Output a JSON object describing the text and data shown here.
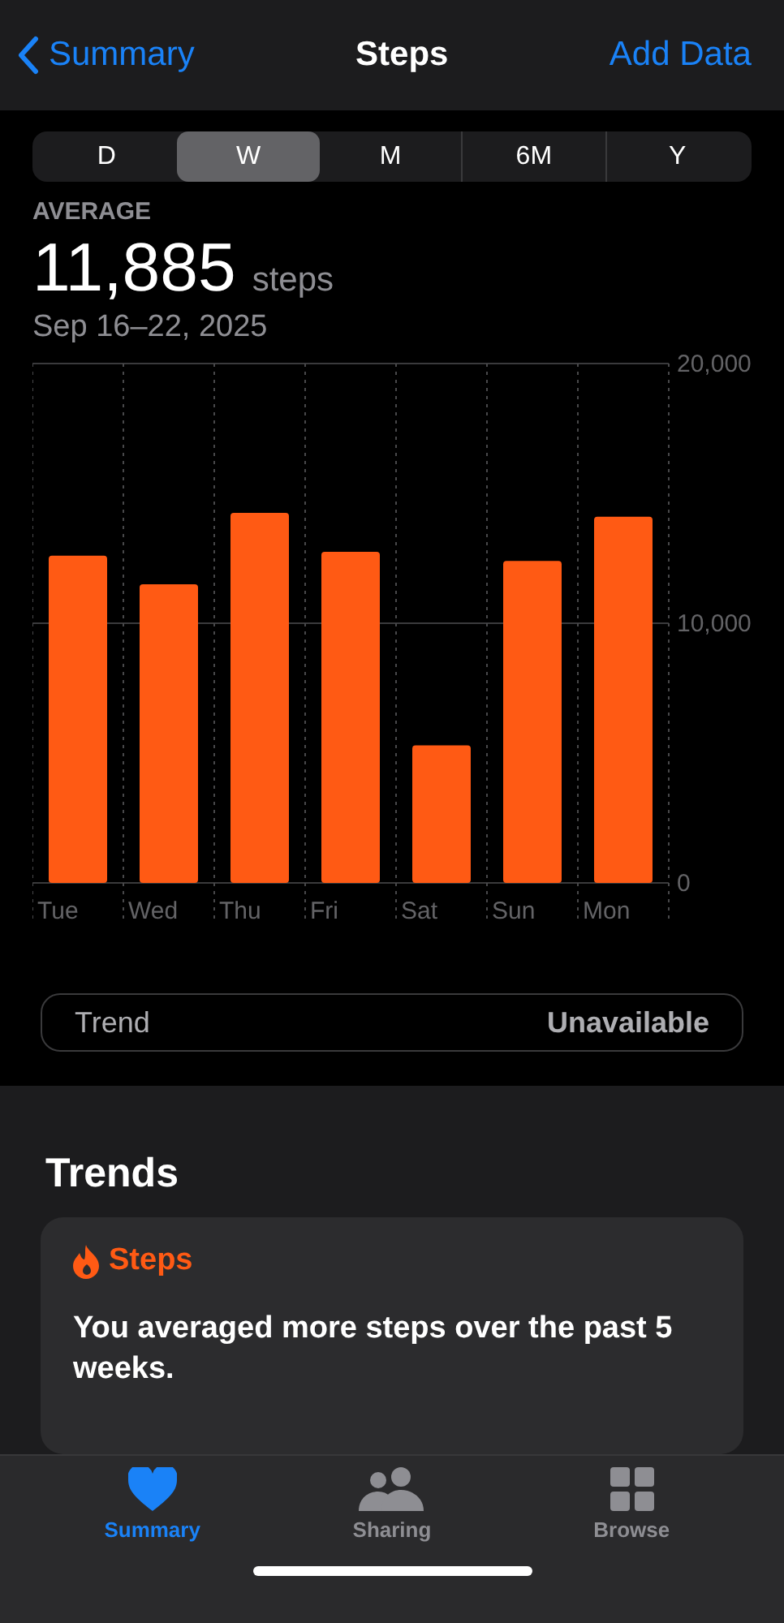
{
  "nav": {
    "back": "Summary",
    "title": "Steps",
    "action": "Add Data"
  },
  "ranges": [
    {
      "label": "D",
      "selected": false
    },
    {
      "label": "W",
      "selected": true
    },
    {
      "label": "M",
      "selected": false
    },
    {
      "label": "6M",
      "selected": false
    },
    {
      "label": "Y",
      "selected": false
    }
  ],
  "summary": {
    "label": "AVERAGE",
    "value": "11,885",
    "unit": "steps",
    "dates": "Sep 16–22, 2025"
  },
  "chart_data": {
    "type": "bar",
    "categories": [
      "Tue",
      "Wed",
      "Thu",
      "Fri",
      "Sat",
      "Sun",
      "Mon"
    ],
    "series": [
      {
        "color": "#ff5a14",
        "values": [
          12600,
          11500,
          14250,
          12750,
          5300,
          12400,
          14100
        ]
      }
    ],
    "ylim": [
      0,
      20000
    ],
    "yticks": [
      {
        "value": 0,
        "label": "0"
      },
      {
        "value": 10000,
        "label": "10,000"
      },
      {
        "value": 20000,
        "label": "20,000"
      }
    ]
  },
  "trend_row": {
    "label": "Trend",
    "value": "Unavailable"
  },
  "trends": {
    "heading": "Trends",
    "card": {
      "title": "Steps",
      "text": "You averaged more steps over the past 5 weeks."
    }
  },
  "tab_bar": [
    {
      "label": "Summary",
      "selected": true
    },
    {
      "label": "Sharing",
      "selected": false
    },
    {
      "label": "Browse",
      "selected": false
    }
  ]
}
